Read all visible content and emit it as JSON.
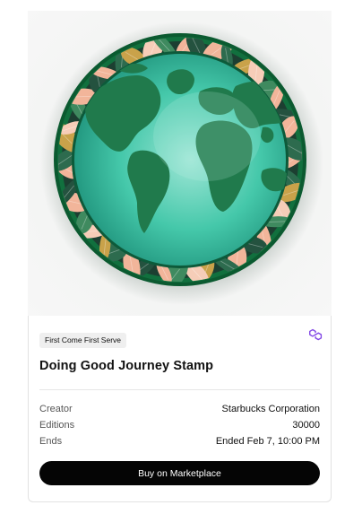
{
  "stamp": {
    "image_name": "earth-globe-floral-stamp",
    "colors": {
      "rim": "#0f6a3a",
      "ocean": "#3cc4a6",
      "land": "#1f7a4a",
      "leaf_pink": "#f2b59a",
      "leaf_gold": "#c9a24a",
      "leaf_dark": "#123c2b"
    }
  },
  "card": {
    "badge": "First Come First Serve",
    "chain_icon": "polygon-icon",
    "title": "Doing Good Journey Stamp",
    "details": [
      {
        "label": "Creator",
        "value": "Starbucks Corporation"
      },
      {
        "label": "Editions",
        "value": "30000"
      },
      {
        "label": "Ends",
        "value": "Ended Feb 7, 10:00 PM"
      }
    ],
    "button_label": "Buy on Marketplace"
  },
  "colors": {
    "accent": "#8247e5",
    "button_bg": "#050505"
  }
}
